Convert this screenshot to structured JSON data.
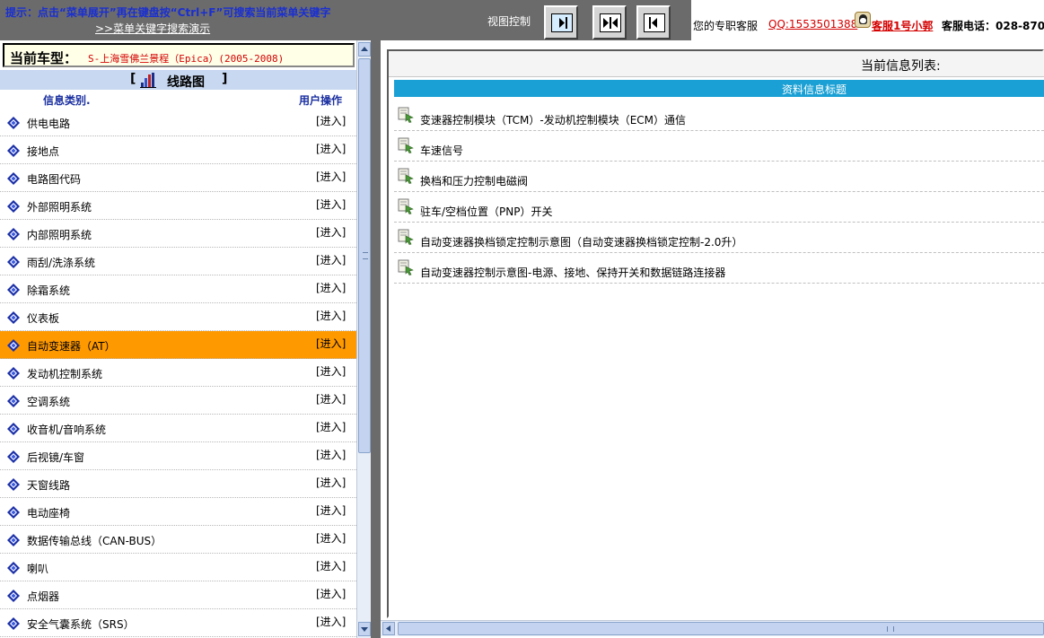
{
  "topbar": {
    "hint": "提示：点击“菜单展开”再在键盘按“Ctrl+F”可搜索当前菜单关键字",
    "hint_link": ">>菜单关键字搜索演示",
    "view_control_label": "视图控制",
    "view_buttons": [
      "expand-right-icon",
      "split-both-icon",
      "expand-left-icon"
    ]
  },
  "service": {
    "intro": "您的专职客服",
    "qq": "QQ:1553501388",
    "name": "客服1号小郭",
    "phone": "客服电话：028-870"
  },
  "vehicle": {
    "label": "当前车型：",
    "value": "S-上海雪佛兰景程（Epica）(2005-2008)"
  },
  "diagram": {
    "title": "线路图",
    "bracket_left": "[",
    "bracket_right": "]"
  },
  "category_table": {
    "col_category": "信息类别.",
    "col_operation": "用户操作",
    "op_label": "[进入]",
    "active_index": 8,
    "items": [
      {
        "label": "供电电路"
      },
      {
        "label": "接地点"
      },
      {
        "label": "电路图代码"
      },
      {
        "label": "外部照明系统"
      },
      {
        "label": "内部照明系统"
      },
      {
        "label": "雨刮/洗涤系统"
      },
      {
        "label": "除霜系统"
      },
      {
        "label": "仪表板"
      },
      {
        "label": "自动变速器（AT）"
      },
      {
        "label": "发动机控制系统"
      },
      {
        "label": "空调系统"
      },
      {
        "label": "收音机/音响系统"
      },
      {
        "label": "后视镜/车窗"
      },
      {
        "label": "天窗线路"
      },
      {
        "label": "电动座椅"
      },
      {
        "label": "数据传输总线（CAN-BUS）"
      },
      {
        "label": "喇叭"
      },
      {
        "label": "点烟器"
      },
      {
        "label": "安全气囊系统（SRS）"
      }
    ]
  },
  "info_panel": {
    "title": "当前信息列表:",
    "column_header": "资料信息标题",
    "items": [
      {
        "label": "变速器控制模块（TCM）-发动机控制模块（ECM）通信"
      },
      {
        "label": "车速信号"
      },
      {
        "label": "换档和压力控制电磁阀"
      },
      {
        "label": "驻车/空档位置（PNP）开关"
      },
      {
        "label": "自动变速器换档锁定控制示意图（自动变速器换档锁定控制-2.0升）"
      },
      {
        "label": "自动变速器控制示意图-电源、接地、保持开关和数据链路连接器"
      }
    ]
  },
  "colors": {
    "active_row": "#ff9900",
    "column_bar": "#1aa0d4",
    "hint_text": "#1a2fd0",
    "service_red": "#d40000",
    "vehicle_box_bg": "#ffffe8"
  }
}
